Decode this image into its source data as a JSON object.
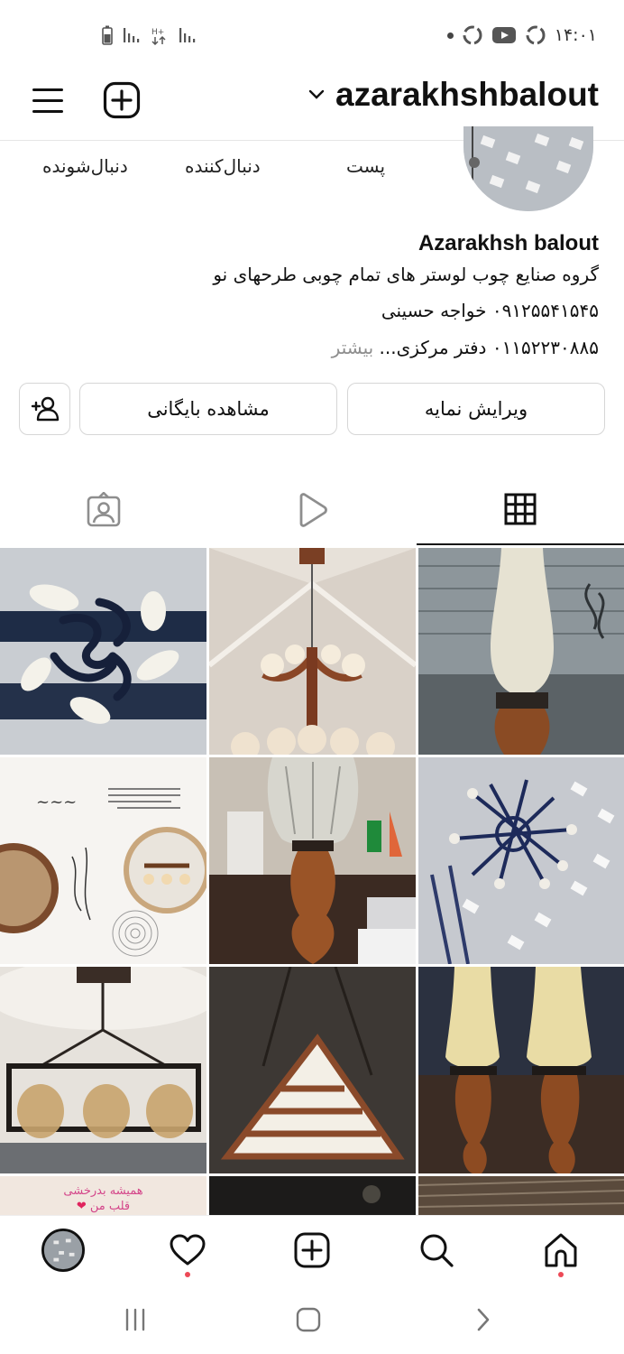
{
  "status_bar": {
    "time": "۱۴:۰۱"
  },
  "header": {
    "username": "azarakhshbalout"
  },
  "profile": {
    "stats": [
      {
        "label": "پست"
      },
      {
        "label": "دنبال‌کننده"
      },
      {
        "label": "دنبال‌شونده"
      }
    ],
    "display_name": "Azarakhsh balout",
    "bio_line_1": "گروه  صنایع  چوب لوستر  های تمام چوبی طرحهای نو",
    "bio_line_2": "۰۹۱۲۵۵۴۱۵۴۵  خواجه حسینی",
    "bio_line_3": "۰۱۱۵۲۲۳۰۸۸۵ دفتر مرکزی...",
    "bio_more": "بیشتر"
  },
  "actions": {
    "edit_profile": "ویرایش نمایه",
    "view_archive": "مشاهده بایگانی"
  },
  "tabs": [
    "grid",
    "reels",
    "tagged"
  ],
  "posts": [
    {
      "subject": "wrought-iron chandelier with white glass shades"
    },
    {
      "subject": "wooden chandelier under pitched white ceiling"
    },
    {
      "subject": "wooden table lamp with frosted glass chimney"
    },
    {
      "subject": "catalog page with round chandelier photos"
    },
    {
      "subject": "wooden lamp with clear glass chimney on office desk"
    },
    {
      "subject": "blue star chandelier under lattice ceiling"
    },
    {
      "subject": "rectangular iron chandelier with amber globes"
    },
    {
      "subject": "hanging wooden triangle lamp"
    },
    {
      "subject": "pair of wooden lamps with etched glass shades"
    },
    {
      "subject": "pink greeting card image",
      "caption_line_1": "همیشه بدرخشی",
      "caption_line_2": "قلب من"
    },
    {
      "subject": "dark photo"
    },
    {
      "subject": "wood texture photo"
    }
  ],
  "colors": {
    "notification_dot": "#ed4956",
    "text": "#111111",
    "muted": "#8e8e8e",
    "border": "#d6d6d6"
  }
}
